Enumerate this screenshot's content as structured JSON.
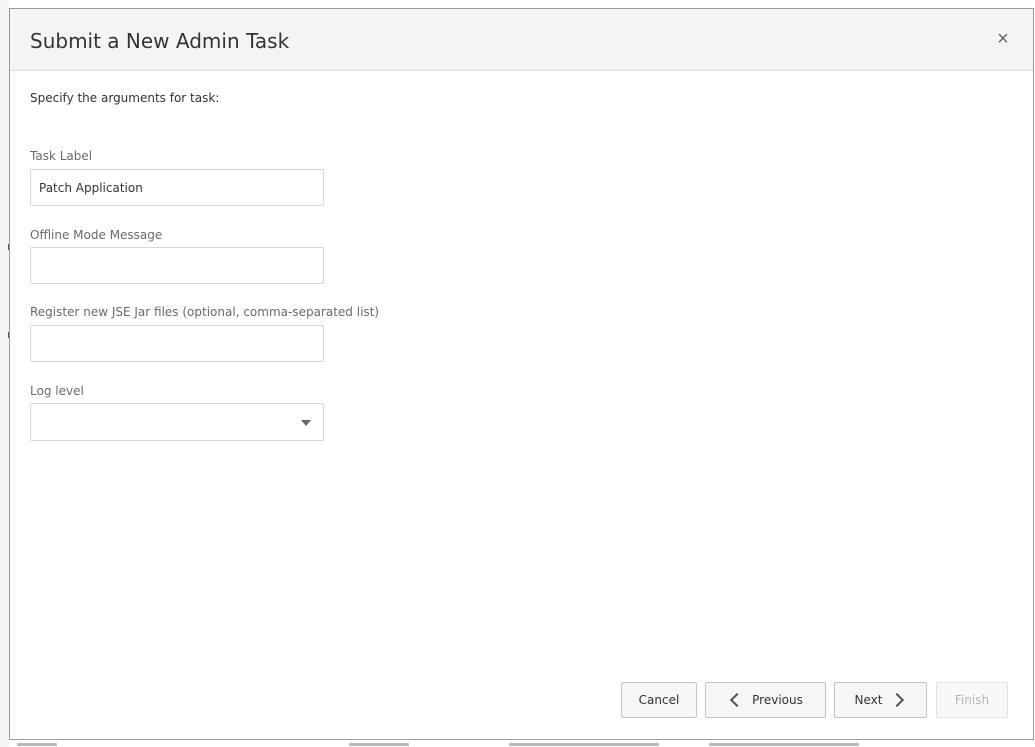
{
  "dialog": {
    "title": "Submit a New Admin Task",
    "close_symbol": "×",
    "intro": "Specify the arguments for task:"
  },
  "form": {
    "task_label": {
      "label": "Task Label",
      "value": "Patch Application"
    },
    "offline_message": {
      "label": "Offline Mode Message",
      "value": ""
    },
    "jar_files": {
      "label": "Register new JSE Jar files (optional, comma-separated list)",
      "value": ""
    },
    "log_level": {
      "label": "Log level",
      "selected": ""
    }
  },
  "footer": {
    "cancel_label": "Cancel",
    "previous_label": "Previous",
    "next_label": "Next",
    "finish_label": "Finish"
  },
  "icons": {
    "close": "close-icon",
    "dropdown": "chevron-down-icon",
    "previous": "chevron-left-icon",
    "next": "chevron-right-icon"
  },
  "colors": {
    "header_bg": "#f4f4f4",
    "border": "#9a9a9a",
    "label_text": "#6a6a6a",
    "disabled_text": "#b5b5b5"
  }
}
